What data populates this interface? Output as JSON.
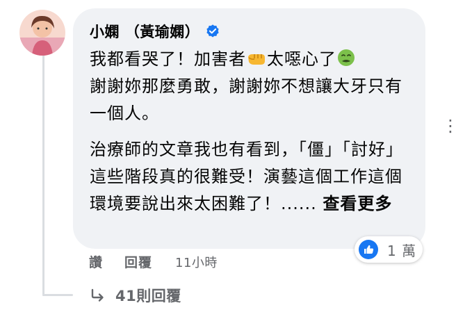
{
  "comment": {
    "author": "小嫻 （黃瑜嫻）",
    "verified": true,
    "paragraphs": [
      [
        "我都看哭了！加害者",
        "太噁心了",
        "謝謝妳那麼勇敢，謝謝妳不想讓大牙只有一個人。"
      ],
      [
        "治療師的文章我也有看到，「僵」「討好」這些階段真的很難受！演藝這個工作這個環境要說出來太困難了！...... ",
        "查看更多"
      ]
    ],
    "emoji": [
      "punch-emoji",
      "nauseated-face-emoji"
    ]
  },
  "reactions": {
    "icon": "like-icon",
    "count": "1 萬",
    "color": "#1877f2"
  },
  "actions": {
    "like": "讚",
    "reply": "回覆",
    "time": "11小時"
  },
  "replies": {
    "label": "41則回覆"
  },
  "menu": {
    "icon": "more-horizontal-icon",
    "glyph": "⋮"
  }
}
